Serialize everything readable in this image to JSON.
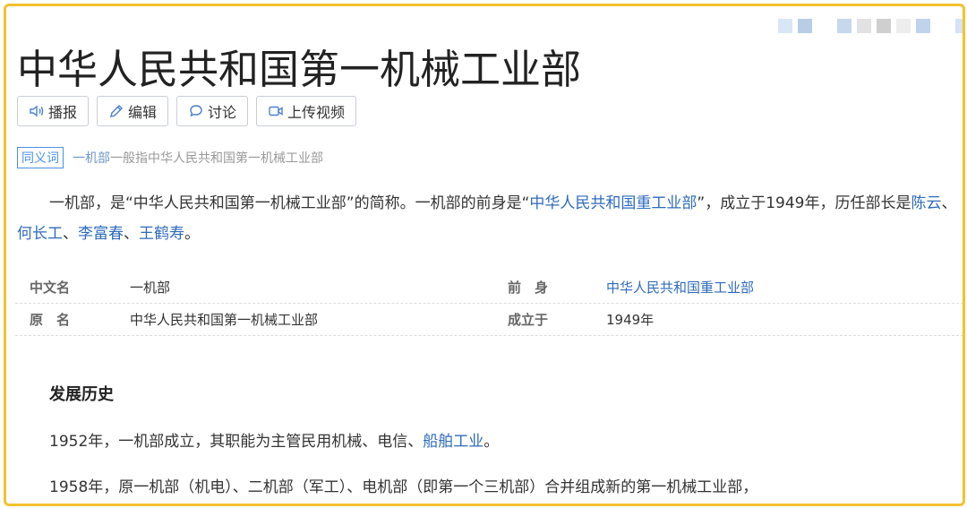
{
  "page": {
    "title": "中华人民共和国第一机械工业部",
    "accent": "#f5c12e",
    "link_color": "#2e6bbd"
  },
  "toolbar": {
    "buttons": [
      {
        "icon": "speaker-icon",
        "label": "播报"
      },
      {
        "icon": "pencil-icon",
        "label": "编辑"
      },
      {
        "icon": "chat-bubble-icon",
        "label": "讨论"
      },
      {
        "icon": "video-camera-icon",
        "label": "上传视频"
      }
    ]
  },
  "synonym": {
    "tag": "同义词",
    "link": "一机部",
    "text": "一般指中华人民共和国第一机械工业部"
  },
  "summary": {
    "part1": "一机部，是“中华人民共和国第一机械工业部”的简称。一机部的前身是“",
    "link_predecessor": "中华人民共和国重工业部",
    "part2": "”，成立于1949年，历任部长是",
    "ministers": [
      "陈云",
      "何长工",
      "李富春",
      "王鹤寿"
    ],
    "sep": "、",
    "end": "。"
  },
  "basic_info": {
    "rows": [
      {
        "name1": "中文名",
        "value1": "一机部",
        "name2": "前　身",
        "value2": "中华人民共和国重工业部",
        "value2_is_link": true
      },
      {
        "name1": "原　名",
        "value1": "中华人民共和国第一机械工业部",
        "name2": "成立于",
        "value2": "1949年",
        "value2_is_link": false
      }
    ]
  },
  "history": {
    "title": "发展历史",
    "para1_prefix": "1952年，一机部成立，其职能为主管民用机械、电信、",
    "para1_link": "船舶工业",
    "para1_suffix": "。",
    "para2": "1958年，原一机部（机电）、二机部（军工）、电机部（即第一个三机部）合并组成新的第一机械工业部，"
  },
  "blurred_strip": {
    "colors": [
      "#d9e6f5",
      "#b8cde6",
      "#ffffff",
      "#c6d7ee",
      "#e2e2e2",
      "#cfcfcf",
      "#ededed",
      "#bfd3ec",
      "#ffffff",
      "#d4e3f5"
    ]
  }
}
